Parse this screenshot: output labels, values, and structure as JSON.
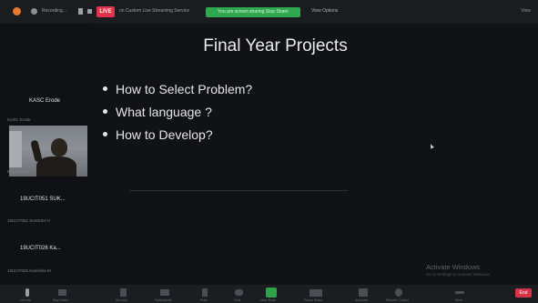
{
  "top_bar": {
    "recording_text": "Recording...",
    "live_label": "LIVE",
    "stream_text": "on Custom Live Streaming Service",
    "sharing_text": "You are screen sharing  Stop Share",
    "view_options": "View Options",
    "right_text": "View"
  },
  "panel": {
    "tiles": [
      {
        "name": "KASC Erode",
        "sub": "KASC Erode"
      },
      {
        "name": "",
        "sub": "Kavi Vijesh"
      },
      {
        "name": "19UCIT051 SUK...",
        "sub": "19UCIT051 SUKESH V"
      },
      {
        "name": "19UCIT026 Ka...",
        "sub": "19UCIT026 Kanishka M"
      }
    ]
  },
  "slide": {
    "title": "Final Year Projects",
    "bullets": [
      "How to Select Problem?",
      "What language ?",
      "How to Develop?"
    ]
  },
  "watermark": {
    "line1": "Activate Windows",
    "line2": "Go to Settings to activate Windows."
  },
  "toolbar": {
    "items": [
      "Unmute",
      "Stop Video",
      "Security",
      "Participants",
      "Polls",
      "Chat",
      "New Share",
      "Pause Share",
      "Annotate",
      "Remote Control",
      "More"
    ],
    "end_label": "End"
  }
}
